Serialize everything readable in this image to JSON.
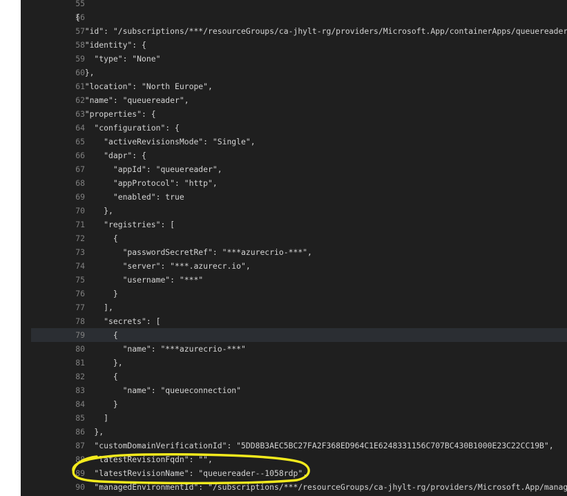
{
  "editor": {
    "lines": [
      {
        "num": "55",
        "text": ""
      },
      {
        "num": "56",
        "text": "{"
      },
      {
        "num": "57",
        "text": "  \"id\": \"/subscriptions/***/resourceGroups/ca-jhylt-rg/providers/Microsoft.App/containerApps/queuereader\","
      },
      {
        "num": "58",
        "text": "  \"identity\": {"
      },
      {
        "num": "59",
        "text": "    \"type\": \"None\""
      },
      {
        "num": "60",
        "text": "  },"
      },
      {
        "num": "61",
        "text": "  \"location\": \"North Europe\","
      },
      {
        "num": "62",
        "text": "  \"name\": \"queuereader\","
      },
      {
        "num": "63",
        "text": "  \"properties\": {"
      },
      {
        "num": "64",
        "text": "    \"configuration\": {"
      },
      {
        "num": "65",
        "text": "      \"activeRevisionsMode\": \"Single\","
      },
      {
        "num": "66",
        "text": "      \"dapr\": {"
      },
      {
        "num": "67",
        "text": "        \"appId\": \"queuereader\","
      },
      {
        "num": "68",
        "text": "        \"appProtocol\": \"http\","
      },
      {
        "num": "69",
        "text": "        \"enabled\": true"
      },
      {
        "num": "70",
        "text": "      },"
      },
      {
        "num": "71",
        "text": "      \"registries\": ["
      },
      {
        "num": "72",
        "text": "        {"
      },
      {
        "num": "73",
        "text": "          \"passwordSecretRef\": \"***azurecrio-***\","
      },
      {
        "num": "74",
        "text": "          \"server\": \"***.azurecr.io\","
      },
      {
        "num": "75",
        "text": "          \"username\": \"***\""
      },
      {
        "num": "76",
        "text": "        }"
      },
      {
        "num": "77",
        "text": "      ],"
      },
      {
        "num": "78",
        "text": "      \"secrets\": ["
      },
      {
        "num": "79",
        "text": "        {"
      },
      {
        "num": "80",
        "text": "          \"name\": \"***azurecrio-***\""
      },
      {
        "num": "81",
        "text": "        },"
      },
      {
        "num": "82",
        "text": "        {"
      },
      {
        "num": "83",
        "text": "          \"name\": \"queueconnection\""
      },
      {
        "num": "84",
        "text": "        }"
      },
      {
        "num": "85",
        "text": "      ]"
      },
      {
        "num": "86",
        "text": "    },"
      },
      {
        "num": "87",
        "text": "    \"customDomainVerificationId\": \"5DD8B3AEC5BC27FA2F368ED964C1E6248331156C707BC430B1000E23C22CC19B\","
      },
      {
        "num": "88",
        "text": "    \"latestRevisionFqdn\": \"\","
      },
      {
        "num": "89",
        "text": "    \"latestRevisionName\": \"queuereader--1058rdp\","
      },
      {
        "num": "90",
        "text": "    \"managedEnvironmentId\": \"/subscriptions/***/resourceGroups/ca-jhylt-rg/providers/Microsoft.App/managedEnvironments/ca-jhylt-env\","
      }
    ]
  },
  "colors": {
    "background": "#1f1f1f",
    "text": "#d4d4d4",
    "line_number": "#808080",
    "current_line": "#2b2e33",
    "annotation": "#f3ea1d"
  },
  "current_line": "79",
  "annotation": {
    "shape": "ellipse",
    "color": "#f3ea1d",
    "marks_lines": [
      "88",
      "89"
    ]
  }
}
